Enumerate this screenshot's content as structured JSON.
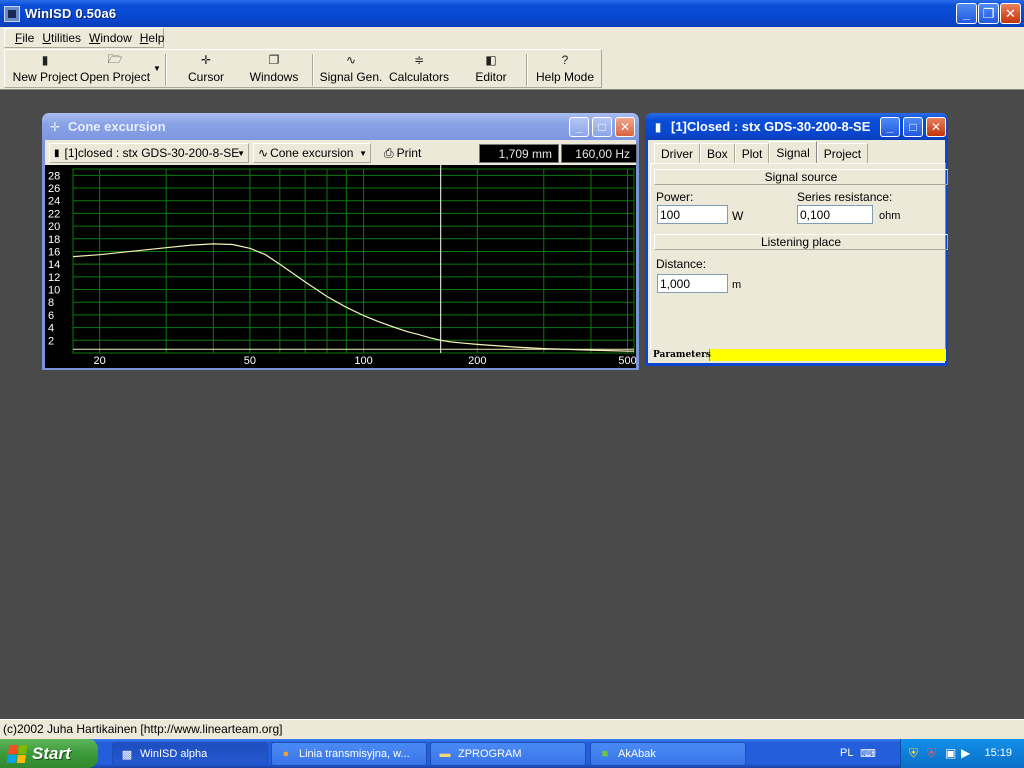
{
  "app": {
    "title": "WinISD 0.50a6",
    "buttons": {
      "minimize": "_",
      "restore": "❐",
      "close": "✕"
    }
  },
  "menu": [
    "File",
    "Utilities",
    "Window",
    "Help"
  ],
  "toolbar": {
    "new_project": "New Project",
    "open_project": "Open Project",
    "cursor": "Cursor",
    "windows": "Windows",
    "signal_gen": "Signal Gen.",
    "calculators": "Calculators",
    "editor": "Editor",
    "help_mode": "Help Mode"
  },
  "cone_window": {
    "title": "Cone excursion",
    "project_combo": "[1]closed : stx GDS-30-200-8-SE",
    "graph_combo": "Cone excursion",
    "print_label": "Print",
    "readout_mm": "1,709 mm",
    "readout_hz": "160,00 Hz"
  },
  "chart_data": {
    "type": "line",
    "x_scale": "log",
    "xlim": [
      17,
      520
    ],
    "ylim": [
      0,
      29
    ],
    "x_ticks": [
      20,
      50,
      100,
      200,
      500
    ],
    "y_ticks": [
      2,
      4,
      6,
      8,
      10,
      12,
      14,
      16,
      18,
      20,
      22,
      24,
      26,
      28
    ],
    "grid": true,
    "cursor_x": 160,
    "series": [
      {
        "x": [
          17,
          20,
          25,
          30,
          35,
          40,
          45,
          50,
          55,
          60,
          70,
          80,
          90,
          100,
          110,
          120,
          130,
          140,
          150,
          160,
          170,
          180,
          200,
          250,
          300,
          400,
          500,
          520
        ],
        "y": [
          15.2,
          15.5,
          16.1,
          16.6,
          17.0,
          17.2,
          17.1,
          16.5,
          15.5,
          14.0,
          11.2,
          8.9,
          7.2,
          5.9,
          4.9,
          4.1,
          3.4,
          2.9,
          2.4,
          2.0,
          1.75,
          1.6,
          1.35,
          0.95,
          0.7,
          0.45,
          0.3,
          0.28
        ]
      }
    ],
    "baseline": 0.6,
    "colors": {
      "background": "#000000",
      "grid": "#0a7a0a",
      "curve": "#f4f4b8",
      "axis_text": "#ffffff"
    }
  },
  "closed_window": {
    "title": "[1]Closed : stx GDS-30-200-8-SE",
    "tabs": [
      "Driver",
      "Box",
      "Plot",
      "Signal",
      "Project"
    ],
    "active_tab": "Signal",
    "signal_source_header": "Signal source",
    "power_label": "Power:",
    "power_value": "100",
    "power_unit": "W",
    "series_res_label": "Series resistance:",
    "series_res_value": "0,100",
    "series_res_unit": "ohm",
    "listening_header": "Listening place",
    "distance_label": "Distance:",
    "distance_value": "1,000",
    "distance_unit": "m",
    "status_tab": "Parameters"
  },
  "statusbar": "(c)2002 Juha Hartikainen [http://www.linearteam.org]",
  "taskbar": {
    "start": "Start",
    "tasks": [
      "WinISD alpha",
      "Linia transmisyjna, w...",
      "ZPROGRAM",
      "AkAbak"
    ],
    "lang": "PL",
    "clock": "15:19"
  }
}
